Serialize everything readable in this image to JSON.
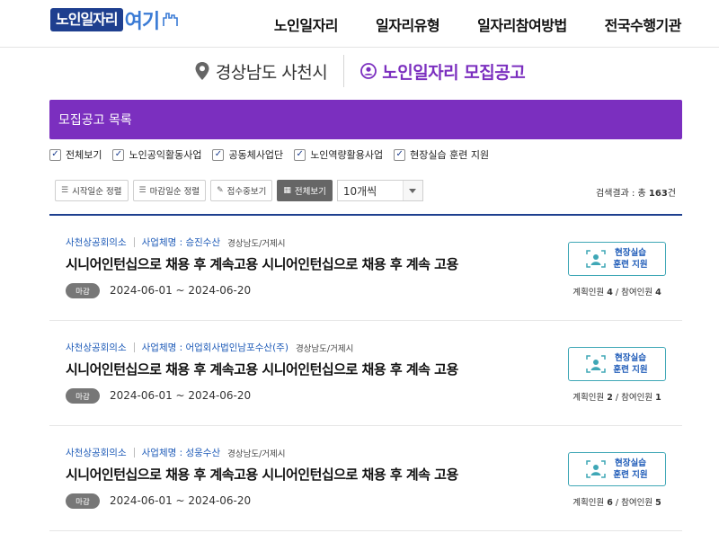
{
  "header": {
    "logo_main": "노인일자리",
    "logo_accent": "여기",
    "nav": [
      "노인일자리",
      "일자리유형",
      "일자리참여방법",
      "전국수행기관"
    ]
  },
  "title": {
    "location": "경상남도 사천시",
    "page": "노인일자리 모집공고"
  },
  "banner": {
    "label": "모집공고 목록"
  },
  "filters": [
    "전체보기",
    "노인공익활동사업",
    "공동체사업단",
    "노인역량활용사업",
    "현장실습 훈련 지원"
  ],
  "toolbar": {
    "sort_start": "시작일순 정렬",
    "sort_end": "마감일순 정렬",
    "open_only": "접수중보기",
    "view_all": "전체보기",
    "page_size": "10개씩"
  },
  "result": {
    "prefix": "검색결과 : 총 ",
    "count": "163",
    "suffix": "건"
  },
  "listings": [
    {
      "org": "사천상공회의소",
      "company_label": "사업체명 : 승진수산",
      "region": "경상남도/거제시",
      "title": "시니어인턴십으로 채용 후 계속고용 시니어인턴십으로 채용 후 계속 고용",
      "status": "마감",
      "dates": "2024-06-01 ~ 2024-06-20",
      "badge_line1": "현장실습",
      "badge_line2": "훈련 지원",
      "plan_label": "계획인원 ",
      "plan": "4",
      "join_label": " / 참여인원 ",
      "join": "4"
    },
    {
      "org": "사천상공회의소",
      "company_label": "사업체명 : 어업회사법인남포수산(주)",
      "region": "경상남도/거제시",
      "title": "시니어인턴십으로 채용 후 계속고용 시니어인턴십으로 채용 후 계속 고용",
      "status": "마감",
      "dates": "2024-06-01 ~ 2024-06-20",
      "badge_line1": "현장실습",
      "badge_line2": "훈련 지원",
      "plan_label": "계획인원 ",
      "plan": "2",
      "join_label": " / 참여인원 ",
      "join": "1"
    },
    {
      "org": "사천상공회의소",
      "company_label": "사업체명 : 성웅수산",
      "region": "경상남도/거제시",
      "title": "시니어인턴십으로 채용 후 계속고용 시니어인턴십으로 채용 후 계속 고용",
      "status": "마감",
      "dates": "2024-06-01 ~ 2024-06-20",
      "badge_line1": "현장실습",
      "badge_line2": "훈련 지원",
      "plan_label": "계획인원 ",
      "plan": "6",
      "join_label": " / 참여인원 ",
      "join": "5"
    }
  ],
  "colors": {
    "brand_navy": "#1e3f8f",
    "accent_purple": "#7b2fbf",
    "link_blue": "#1e5bb8",
    "badge_teal": "#3fa7b6"
  },
  "icons": [
    "location-pin-icon",
    "person-circle-icon",
    "checkbox-check-icon",
    "list-icon",
    "pencil-icon",
    "grid-icon",
    "chevron-down-icon",
    "trainee-icon"
  ]
}
